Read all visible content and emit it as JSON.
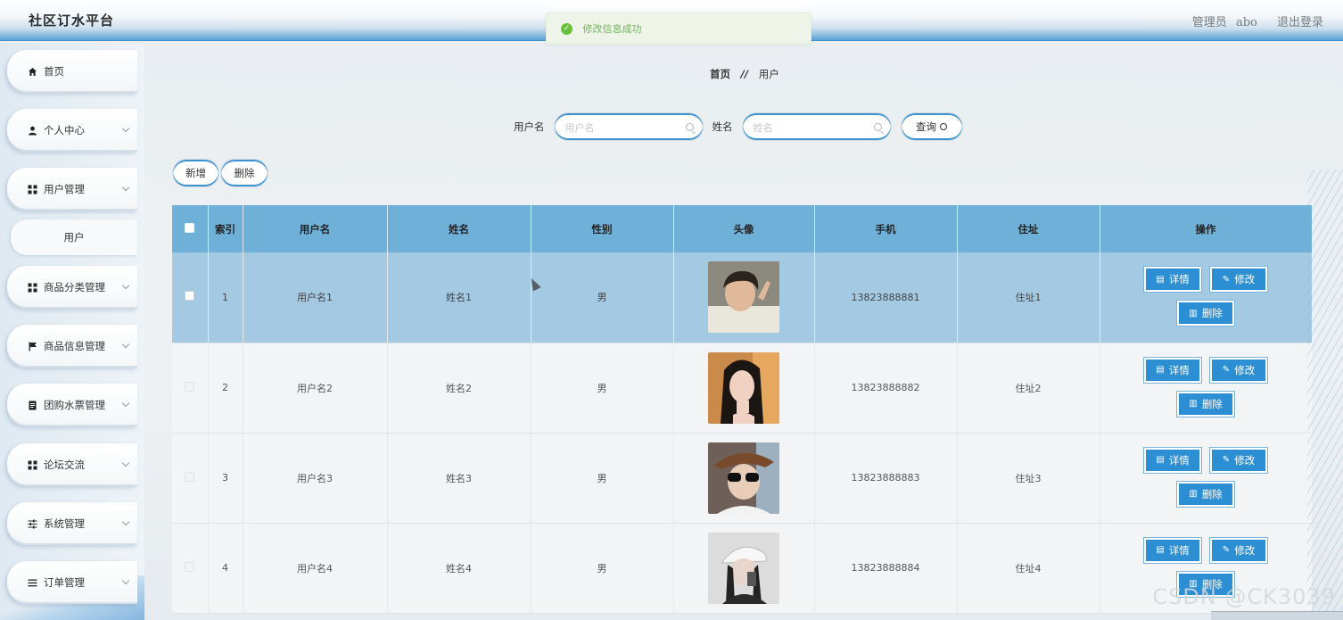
{
  "header": {
    "brand": "社区订水平台",
    "role_label": "管理员",
    "username": "abo",
    "logout_label": "退出登录"
  },
  "toast": {
    "message": "修改信息成功",
    "icon": "check-circle-icon",
    "color": "#67c23a"
  },
  "sidebar": {
    "items": [
      {
        "label": "首页",
        "icon": "home-icon"
      },
      {
        "label": "个人中心",
        "icon": "user-icon"
      },
      {
        "label": "用户管理",
        "icon": "grid-icon"
      },
      {
        "label": "商品分类管理",
        "icon": "grid-icon"
      },
      {
        "label": "商品信息管理",
        "icon": "flag-icon"
      },
      {
        "label": "团购水票管理",
        "icon": "document-icon"
      },
      {
        "label": "论坛交流",
        "icon": "grid-icon"
      },
      {
        "label": "系统管理",
        "icon": "sliders-icon"
      },
      {
        "label": "订单管理",
        "icon": "list-icon"
      }
    ],
    "subitem": "用户"
  },
  "breadcrumb": {
    "home": "首页",
    "separator": "//",
    "current": "用户"
  },
  "search": {
    "username_label": "用户名",
    "username_placeholder": "用户名",
    "username_value": "",
    "name_label": "姓名",
    "name_placeholder": "姓名",
    "name_value": "",
    "query_label": "查询"
  },
  "actions": {
    "add_label": "新增",
    "delete_label": "删除"
  },
  "table": {
    "columns": [
      "索引",
      "用户名",
      "姓名",
      "性别",
      "头像",
      "手机",
      "住址",
      "操作"
    ],
    "rows": [
      {
        "index": "1",
        "username": "用户名1",
        "name": "姓名1",
        "gender": "男",
        "phone": "13823888881",
        "address": "住址1"
      },
      {
        "index": "2",
        "username": "用户名2",
        "name": "姓名2",
        "gender": "男",
        "phone": "13823888882",
        "address": "住址2"
      },
      {
        "index": "3",
        "username": "用户名3",
        "name": "姓名3",
        "gender": "男",
        "phone": "13823888883",
        "address": "住址3"
      },
      {
        "index": "4",
        "username": "用户名4",
        "name": "姓名4",
        "gender": "男",
        "phone": "13823888884",
        "address": "住址4"
      }
    ],
    "row_actions": {
      "detail": "详情",
      "edit": "修改",
      "delete": "删除"
    },
    "header_color": "#6fb0d8",
    "selected_row_color": "#a3c9e3"
  },
  "watermark": "CSDN @CK3039",
  "colors": {
    "accent": "#2c8fd3",
    "border_accent": "#3c91d0"
  }
}
